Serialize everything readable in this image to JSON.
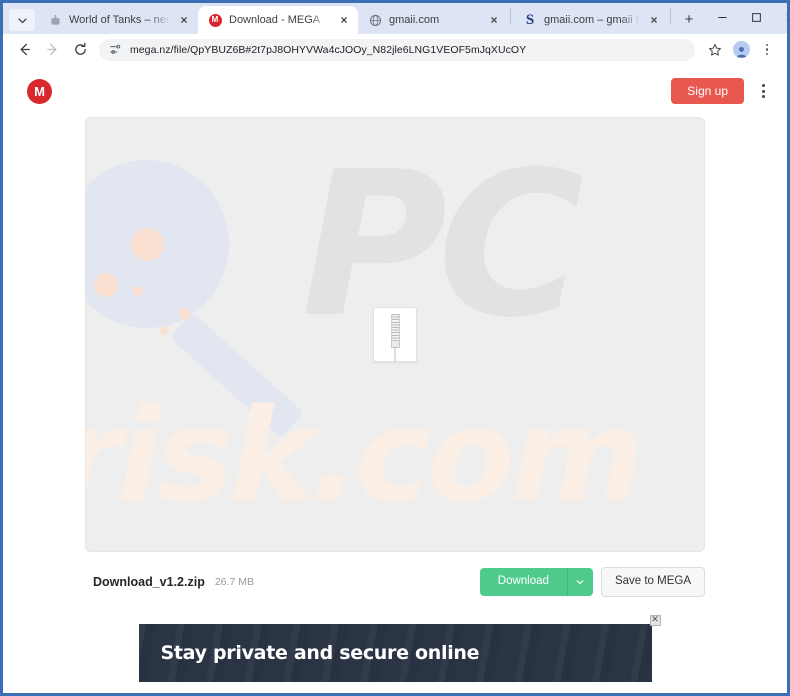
{
  "browser": {
    "tab_search_icon": "chevron-down-icon",
    "tabs": [
      {
        "title": "World of Tanks – nemokam",
        "favicon": "tank-icon",
        "active": false,
        "close_label": "×"
      },
      {
        "title": "Download - MEGA",
        "favicon": "mega-icon",
        "active": true,
        "close_label": "×"
      },
      {
        "title": "gmaii.com",
        "favicon": "globe-icon",
        "active": false,
        "close_label": "×"
      },
      {
        "title": "gmaii.com – gmaii Resourc",
        "favicon": "sedo-s-icon",
        "active": false,
        "close_label": "×"
      }
    ],
    "new_tab_label": "+",
    "window_controls": {
      "minimize": "minimize-icon",
      "maximize": "maximize-icon",
      "close": "close-icon"
    },
    "toolbar": {
      "back": "back-arrow-icon",
      "forward": "forward-arrow-icon",
      "reload": "reload-icon",
      "site_info_icon": "site-settings-icon",
      "url": "mega.nz/file/QpYBUZ6B#2t7pJ8OHYVWa4cJOOy_N82jle6LNG1VEOF5mJqXUcOY",
      "bookmark": "star-icon",
      "profile": "profile-avatar-icon",
      "menu": "three-dot-menu-icon"
    }
  },
  "mega": {
    "logo_letter": "M",
    "signup_label": "Sign up",
    "menu_icon": "three-dot-menu-icon",
    "preview": {
      "file_icon": "zip-file-icon",
      "watermark_primary": "PC",
      "watermark_secondary": "risk.com"
    },
    "file": {
      "name": "Download_v1.2.zip",
      "size": "26.7 MB"
    },
    "actions": {
      "download_label": "Download",
      "download_caret_icon": "chevron-down-icon",
      "save_label": "Save to MEGA"
    }
  },
  "ad": {
    "headline": "Stay private and secure online",
    "close_label": "✕"
  },
  "colors": {
    "mega_red": "#d9272e",
    "signup_red": "#e8584f",
    "download_green": "#4ecb8a",
    "ad_navy": "#2a3444",
    "window_border_blue": "#3b6fb6",
    "watermark_gray": "#e2e2e2",
    "watermark_peach": "#faeee5"
  }
}
